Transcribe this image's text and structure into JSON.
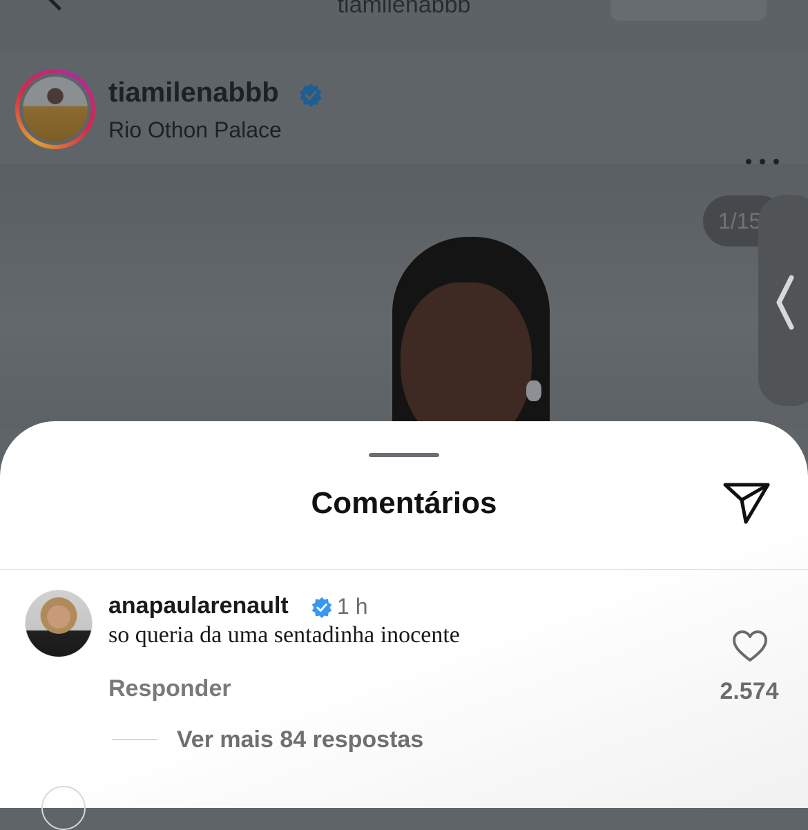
{
  "topbar": {
    "title": "tiamilenabbb"
  },
  "post": {
    "username": "tiamilenabbb",
    "location": "Rio Othon Palace",
    "image_counter": "1/15"
  },
  "comments_sheet": {
    "title": "Comentários",
    "comment": {
      "username": "anapaularenault",
      "time": "1 h",
      "text": "so queria da uma sentadinha inocente",
      "reply_label": "Responder",
      "like_count": "2.574",
      "view_replies": "Ver mais 84 respostas"
    }
  },
  "icons": {
    "verified": "verified-badge-icon",
    "share": "paper-plane-icon",
    "like": "heart-icon",
    "more": "more-dots-icon",
    "back": "chevron-left-icon"
  },
  "colors": {
    "verified_blue": "#3897f0",
    "story_ring_start": "#e0a030",
    "story_ring_end": "#b02a9a"
  }
}
